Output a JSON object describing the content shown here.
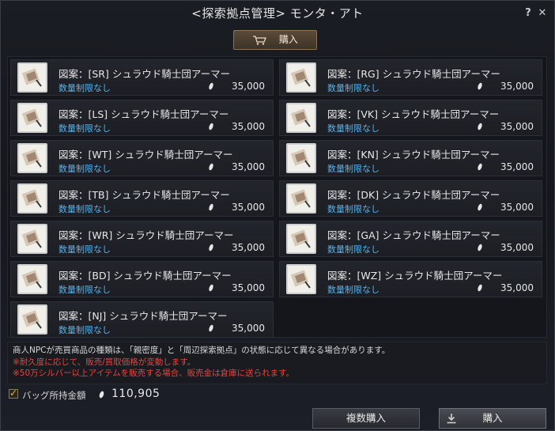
{
  "window": {
    "title": "<探索拠点管理> モンタ・アト",
    "help_label": "?",
    "close_label": "✕"
  },
  "top_buy_button": {
    "label": "購入",
    "icon": "cart-icon"
  },
  "items_left": [
    {
      "name": "図案：[SR] シュラウド騎士団アーマー",
      "limit": "数量制限なし",
      "price": "35,000"
    },
    {
      "name": "図案：[LS] シュラウド騎士団アーマー",
      "limit": "数量制限なし",
      "price": "35,000"
    },
    {
      "name": "図案：[WT] シュラウド騎士団アーマー",
      "limit": "数量制限なし",
      "price": "35,000"
    },
    {
      "name": "図案：[TB] シュラウド騎士団アーマー",
      "limit": "数量制限なし",
      "price": "35,000"
    },
    {
      "name": "図案：[WR] シュラウド騎士団アーマー",
      "limit": "数量制限なし",
      "price": "35,000"
    },
    {
      "name": "図案：[BD] シュラウド騎士団アーマー",
      "limit": "数量制限なし",
      "price": "35,000"
    },
    {
      "name": "図案：[NJ] シュラウド騎士団アーマー",
      "limit": "数量制限なし",
      "price": "35,000"
    }
  ],
  "items_right": [
    {
      "name": "図案：[RG] シュラウド騎士団アーマー",
      "limit": "数量制限なし",
      "price": "35,000"
    },
    {
      "name": "図案：[VK] シュラウド騎士団アーマー",
      "limit": "数量制限なし",
      "price": "35,000"
    },
    {
      "name": "図案：[KN] シュラウド騎士団アーマー",
      "limit": "数量制限なし",
      "price": "35,000"
    },
    {
      "name": "図案：[DK] シュラウド騎士団アーマー",
      "limit": "数量制限なし",
      "price": "35,000"
    },
    {
      "name": "図案：[GA] シュラウド騎士団アーマー",
      "limit": "数量制限なし",
      "price": "35,000"
    },
    {
      "name": "図案：[WZ] シュラウド騎士団アーマー",
      "limit": "数量制限なし",
      "price": "35,000"
    }
  ],
  "notice": {
    "line1": "商人NPCが売買商品の種類は、「親密度」と「周辺探索拠点」の状態に応じて異なる場合があります。",
    "line2": "※耐久度に応じて、販売/買取価格が変動します。",
    "line3": "※50万シルバー以上アイテムを販売する場合、販売金は倉庫に送られます。"
  },
  "footer": {
    "bag_label": "バッグ所持金額",
    "bag_checked": true,
    "amount": "110,905",
    "multi_buy_label": "複数購入",
    "buy_label": "購入"
  },
  "colors": {
    "limit_text": "#5ab0e6",
    "warning_text": "#e2463e",
    "checkmark": "#e9b544"
  }
}
